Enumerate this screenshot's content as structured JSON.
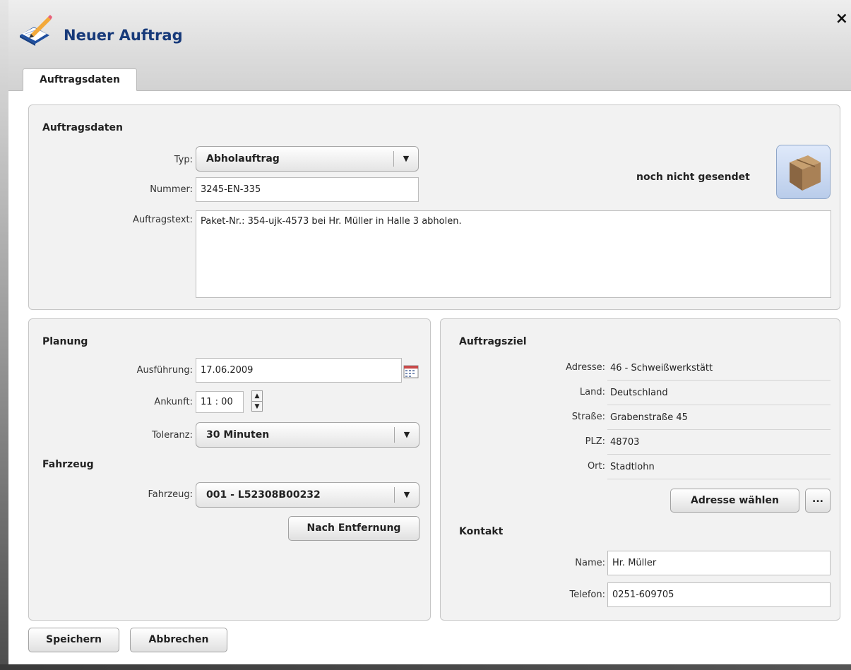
{
  "window": {
    "title": "Neuer Auftrag",
    "close_glyph": "×"
  },
  "tabs": [
    {
      "label": "Auftragsdaten",
      "active": true
    }
  ],
  "order": {
    "section_title": "Auftragsdaten",
    "typ_label": "Typ:",
    "typ_value": "Abholauftrag",
    "nummer_label": "Nummer:",
    "nummer_value": "3245-EN-335",
    "text_label": "Auftragstext:",
    "text_value": "Paket-Nr.: 354-ujk-4573 bei Hr. Müller in Halle 3 abholen.",
    "status": "noch nicht gesendet",
    "status_icon": "package-box-icon"
  },
  "planning": {
    "section_title": "Planung",
    "ausfuehrung_label": "Ausführung:",
    "ausfuehrung_value": "17.06.2009",
    "ankunft_label": "Ankunft:",
    "ankunft_value": "11 : 00",
    "toleranz_label": "Toleranz:",
    "toleranz_value": "30 Minuten"
  },
  "vehicle": {
    "section_title": "Fahrzeug",
    "fahrzeug_label": "Fahrzeug:",
    "fahrzeug_value": "001 - L52308B00232",
    "nach_entfernung_button": "Nach Entfernung"
  },
  "target": {
    "section_title": "Auftragsziel",
    "fields": [
      {
        "label": "Adresse:",
        "value": "46 - Schweißwerkstätt"
      },
      {
        "label": "Land:",
        "value": "Deutschland"
      },
      {
        "label": "Straße:",
        "value": "Grabenstraße 45"
      },
      {
        "label": "PLZ:",
        "value": "48703"
      },
      {
        "label": "Ort:",
        "value": "Stadtlohn"
      }
    ],
    "adresse_waehlen_button": "Adresse wählen",
    "more_button": "..."
  },
  "contact": {
    "section_title": "Kontakt",
    "name_label": "Name:",
    "name_value": "Hr. Müller",
    "telefon_label": "Telefon:",
    "telefon_value": "0251-609705"
  },
  "footer": {
    "save_button": "Speichern",
    "cancel_button": "Abbrechen"
  },
  "colors": {
    "title_text": "#173a7a",
    "panel_bg": "#f2f2f2",
    "status_icon_bg": "#c9d8f2"
  }
}
